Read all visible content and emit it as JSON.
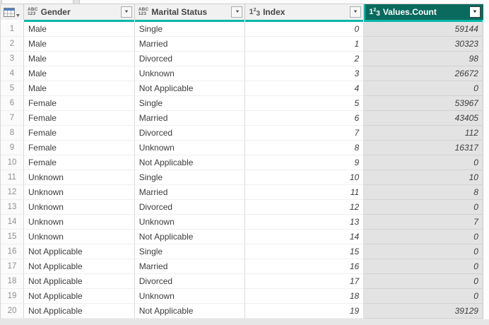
{
  "colors": {
    "accent_teal": "#00b7a8",
    "selected_header_bg": "#0b6a5e",
    "header_bg": "#f1f1f1",
    "selected_cell_bg": "#e3e3e3",
    "corner_icon_blue": "#4f81c7"
  },
  "icons": {
    "abc123": {
      "top": "ABC",
      "bottom": "123"
    },
    "number": {
      "base": "1",
      "sup": "2",
      "sub": "3"
    },
    "dropdown_arrow": "▼",
    "corner_caret": "▼"
  },
  "table": {
    "columns": [
      {
        "name": "Gender",
        "type": "text",
        "selected": false
      },
      {
        "name": "Marital Status",
        "type": "text",
        "selected": false
      },
      {
        "name": "Index",
        "type": "number",
        "selected": false
      },
      {
        "name": "Values.Count",
        "type": "number",
        "selected": true
      }
    ],
    "rows": [
      {
        "n": 1,
        "gender": "Male",
        "marital_status": "Single",
        "index": 0,
        "values_count": 59144
      },
      {
        "n": 2,
        "gender": "Male",
        "marital_status": "Married",
        "index": 1,
        "values_count": 30323
      },
      {
        "n": 3,
        "gender": "Male",
        "marital_status": "Divorced",
        "index": 2,
        "values_count": 98
      },
      {
        "n": 4,
        "gender": "Male",
        "marital_status": "Unknown",
        "index": 3,
        "values_count": 26672
      },
      {
        "n": 5,
        "gender": "Male",
        "marital_status": "Not Applicable",
        "index": 4,
        "values_count": 0
      },
      {
        "n": 6,
        "gender": "Female",
        "marital_status": "Single",
        "index": 5,
        "values_count": 53967
      },
      {
        "n": 7,
        "gender": "Female",
        "marital_status": "Married",
        "index": 6,
        "values_count": 43405
      },
      {
        "n": 8,
        "gender": "Female",
        "marital_status": "Divorced",
        "index": 7,
        "values_count": 112
      },
      {
        "n": 9,
        "gender": "Female",
        "marital_status": "Unknown",
        "index": 8,
        "values_count": 16317
      },
      {
        "n": 10,
        "gender": "Female",
        "marital_status": "Not Applicable",
        "index": 9,
        "values_count": 0
      },
      {
        "n": 11,
        "gender": "Unknown",
        "marital_status": "Single",
        "index": 10,
        "values_count": 10
      },
      {
        "n": 12,
        "gender": "Unknown",
        "marital_status": "Married",
        "index": 11,
        "values_count": 8
      },
      {
        "n": 13,
        "gender": "Unknown",
        "marital_status": "Divorced",
        "index": 12,
        "values_count": 0
      },
      {
        "n": 14,
        "gender": "Unknown",
        "marital_status": "Unknown",
        "index": 13,
        "values_count": 7
      },
      {
        "n": 15,
        "gender": "Unknown",
        "marital_status": "Not Applicable",
        "index": 14,
        "values_count": 0
      },
      {
        "n": 16,
        "gender": "Not Applicable",
        "marital_status": "Single",
        "index": 15,
        "values_count": 0
      },
      {
        "n": 17,
        "gender": "Not Applicable",
        "marital_status": "Married",
        "index": 16,
        "values_count": 0
      },
      {
        "n": 18,
        "gender": "Not Applicable",
        "marital_status": "Divorced",
        "index": 17,
        "values_count": 0
      },
      {
        "n": 19,
        "gender": "Not Applicable",
        "marital_status": "Unknown",
        "index": 18,
        "values_count": 0
      },
      {
        "n": 20,
        "gender": "Not Applicable",
        "marital_status": "Not Applicable",
        "index": 19,
        "values_count": 39129
      }
    ]
  }
}
